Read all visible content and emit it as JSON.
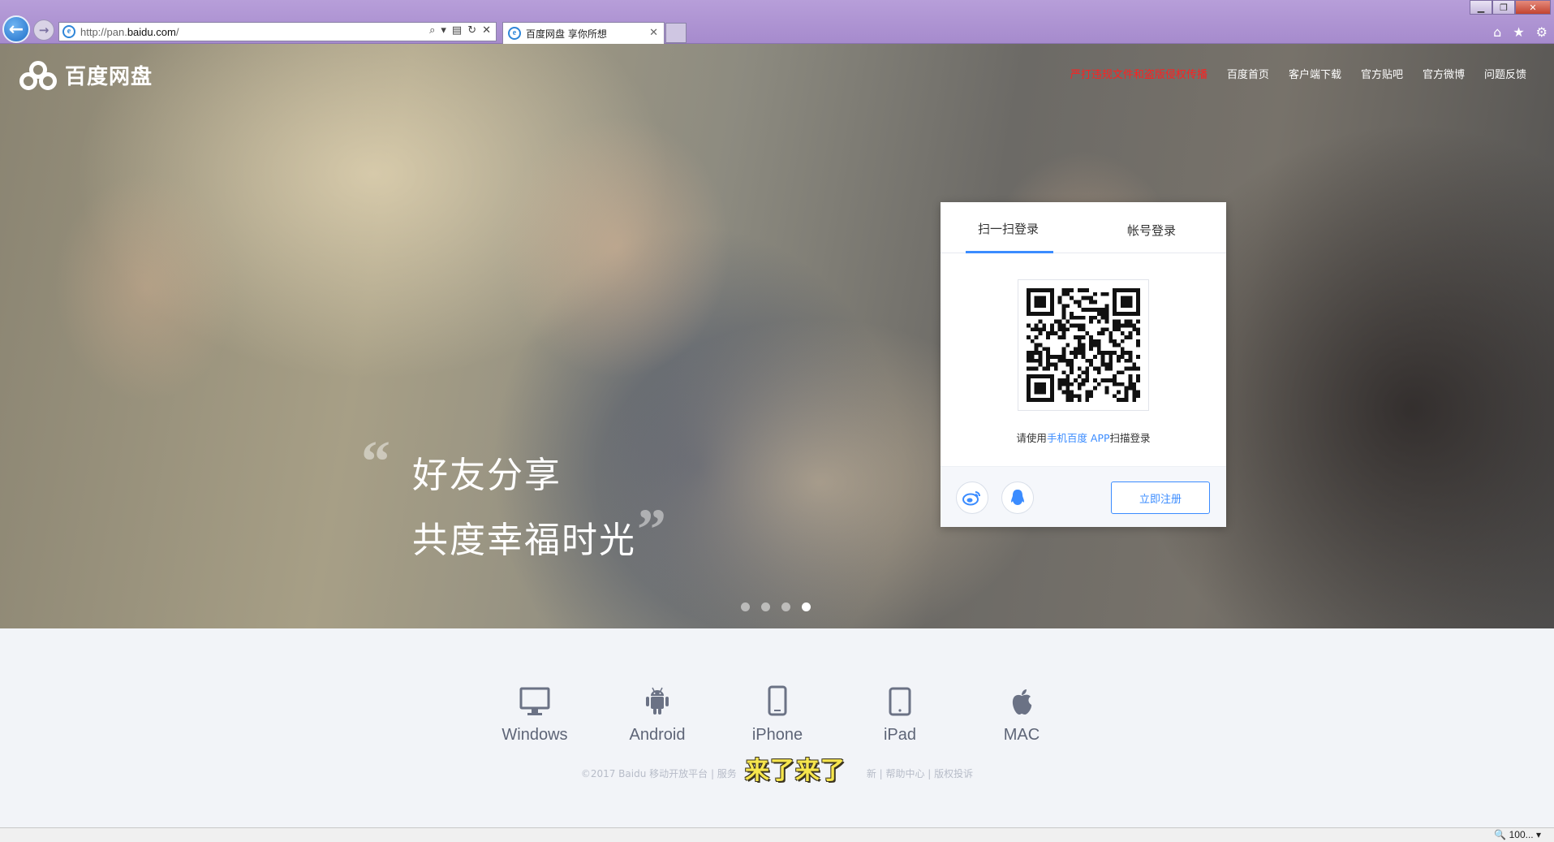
{
  "browser": {
    "url_prefix": "http://pan.",
    "url_domain": "baidu.com",
    "url_suffix": "/",
    "tab_title": "百度网盘 享你所想",
    "zoom": "100..."
  },
  "header": {
    "logo_text": "百度网盘",
    "nav": [
      "严打违规文件和盗版侵权传播",
      "百度首页",
      "客户端下载",
      "官方贴吧",
      "官方微博",
      "问题反馈"
    ]
  },
  "hero": {
    "slogan_line1": "好友分享",
    "slogan_line2": "共度幸福时光",
    "carousel_count": 4,
    "carousel_active": 4
  },
  "login": {
    "tab_qr": "扫一扫登录",
    "tab_account": "帐号登录",
    "hint_prefix": "请使用",
    "hint_link": "手机百度 APP",
    "hint_suffix": "扫描登录",
    "register": "立即注册"
  },
  "platforms": [
    {
      "label": "Windows",
      "icon": "monitor-icon"
    },
    {
      "label": "Android",
      "icon": "android-icon"
    },
    {
      "label": "iPhone",
      "icon": "iphone-icon"
    },
    {
      "label": "iPad",
      "icon": "ipad-icon"
    },
    {
      "label": "MAC",
      "icon": "apple-icon"
    }
  ],
  "footer": {
    "left": "©2017 Baidu 移动开放平台 | 服务",
    "right": "新 | 帮助中心 | 版权投诉"
  },
  "overlay": "来了来了",
  "colors": {
    "accent": "#3b8cff",
    "warn": "#ff2020",
    "chrome": "#a68bcd"
  }
}
